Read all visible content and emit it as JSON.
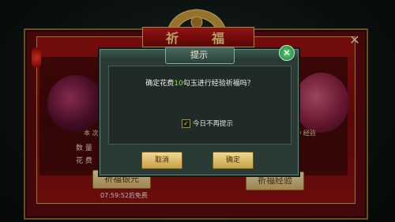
{
  "background": {
    "title_chars": [
      "祈",
      "福"
    ],
    "left_panel": {
      "label_count_suffix": "本 次",
      "quantity_label": "数 量",
      "cost_label": "花 费"
    },
    "right_panel": {
      "exp_text": "20 经验"
    },
    "buttons": {
      "pray_silver": "祈福银元",
      "pray_exp": "祈福经验"
    },
    "timer_text": "07:59:52后免费"
  },
  "dialog": {
    "title": "提示",
    "message_prefix": "确定花费",
    "message_amount": "10",
    "message_suffix": "勾玉进行经验祈福吗？",
    "checkbox_label": "今日不再提示",
    "checkbox_checked": true,
    "cancel_label": "取消",
    "confirm_label": "确定"
  },
  "icons": {
    "close": "close-icon",
    "dialog_close": "close-icon",
    "check": "check-icon"
  },
  "colors": {
    "highlight_amount": "#8ee84a",
    "panel_red": "#9b1212",
    "gold_button": "#d4b26a"
  }
}
